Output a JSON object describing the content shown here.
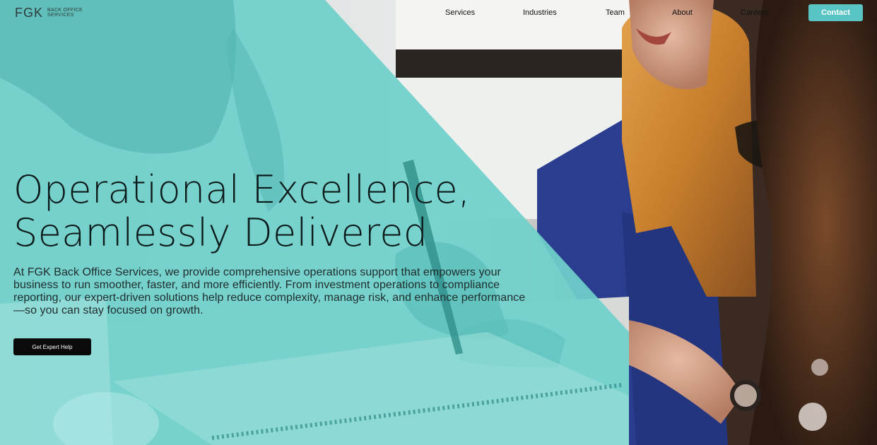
{
  "brand": {
    "mark": "FGK",
    "sub_line_1": "BACK OFFICE",
    "sub_line_2": "SERVICES"
  },
  "nav": {
    "items": [
      {
        "label": "Services"
      },
      {
        "label": "Industries"
      },
      {
        "label": "Team"
      },
      {
        "label": "About"
      },
      {
        "label": "Careers"
      }
    ],
    "contact_label": "Contact"
  },
  "hero": {
    "title_line_1": "Operational Excellence,",
    "title_line_2": "Seamlessly Delivered",
    "body_lines": [
      "At FGK Back Office Services, we provide comprehensive operations support that empowers your",
      "business to run smoother, faster, and more efficiently. From investment operations to compliance",
      "reporting, our expert-driven solutions help reduce complexity, manage risk, and enhance performance",
      "—so you can stay focused on growth."
    ],
    "cta_label": "Get Expert Help"
  },
  "colors": {
    "accent": "#59c4c4",
    "overlay_teal": "#5ec9c4",
    "cta_bg": "#0a0a0a"
  }
}
